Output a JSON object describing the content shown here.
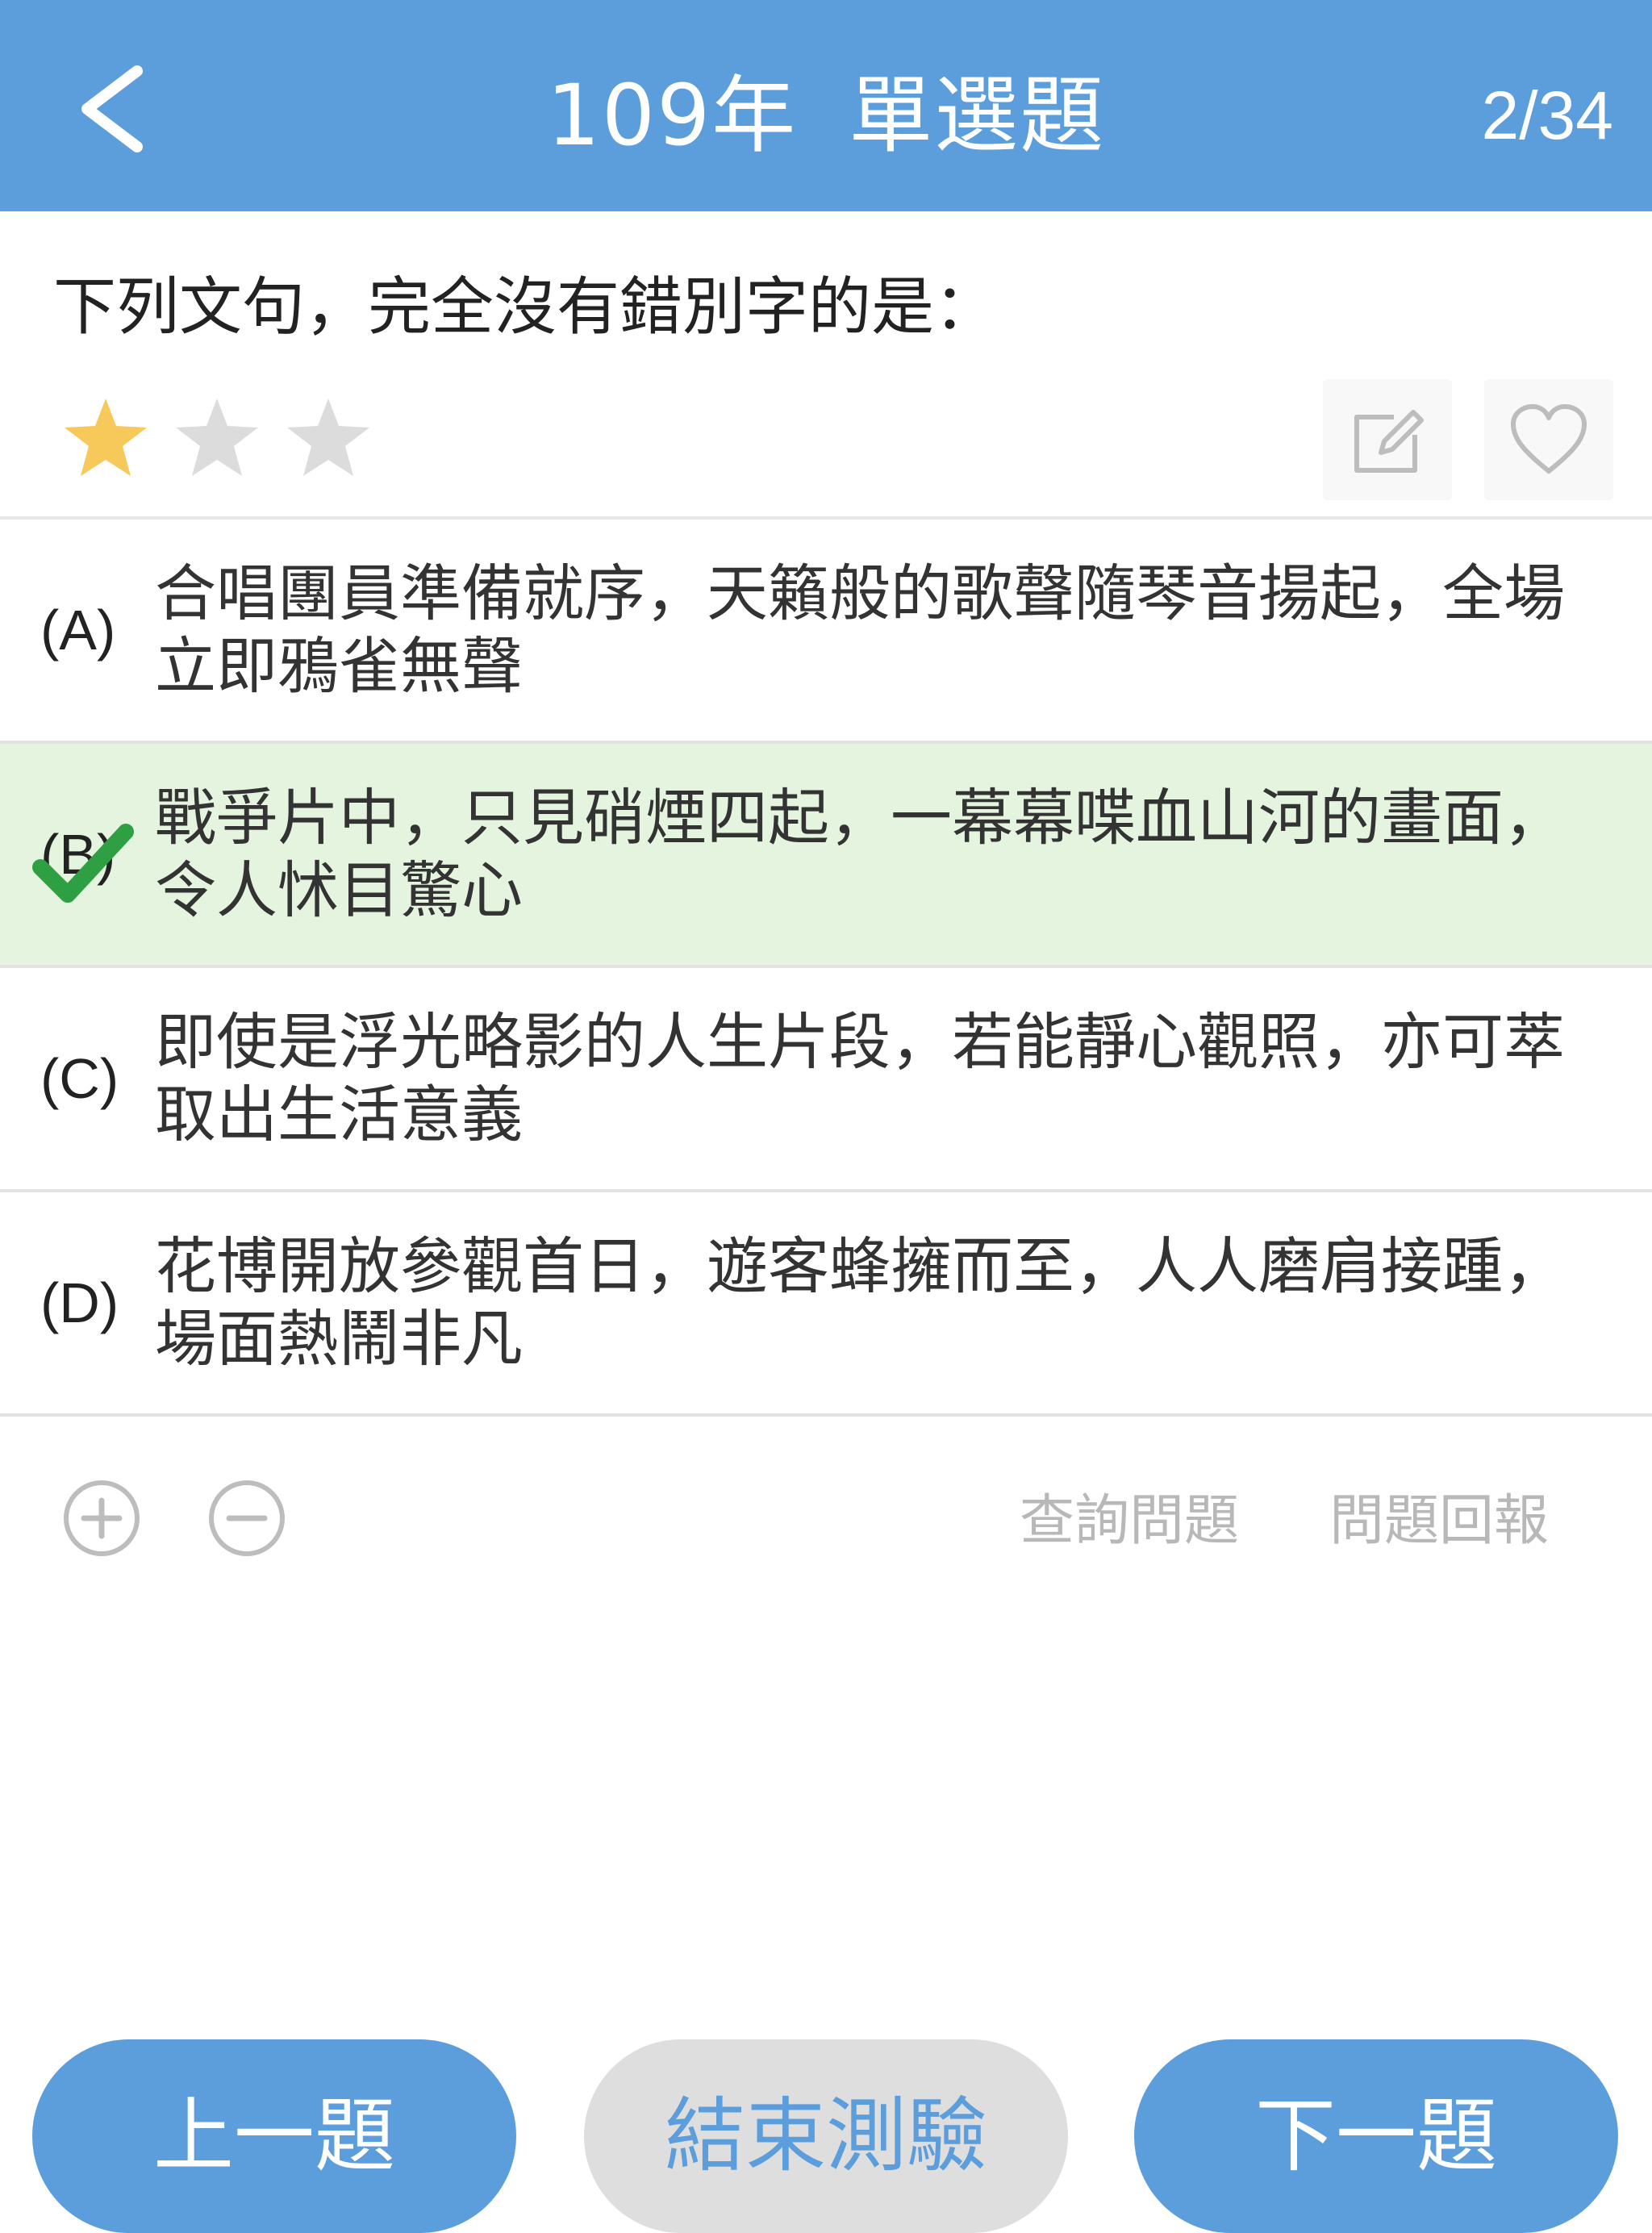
{
  "header": {
    "year": "109年",
    "title": "單選題",
    "counter": "2/34"
  },
  "question": {
    "text": "下列文句，完全沒有錯別字的是：",
    "difficulty_stars": 1,
    "max_stars": 3
  },
  "options": [
    {
      "letter": "(A)",
      "text": "合唱團員準備就序，天籟般的歌聲隨琴音揚起，全場立即鴉雀無聲",
      "selected": false
    },
    {
      "letter": "(B)",
      "text": "戰爭片中，只見硝煙四起，一幕幕喋血山河的畫面，令人怵目驚心",
      "selected": true
    },
    {
      "letter": "(C)",
      "text": "即使是浮光略影的人生片段，若能靜心觀照，亦可萃取出生活意義",
      "selected": false
    },
    {
      "letter": "(D)",
      "text": "花博開放參觀首日，遊客蜂擁而至，人人磨肩接踵，場面熱鬧非凡",
      "selected": false
    }
  ],
  "links": {
    "query": "查詢問題",
    "report": "問題回報"
  },
  "buttons": {
    "prev": "上一題",
    "end": "結束測驗",
    "next": "下一題"
  },
  "colors": {
    "header": "#5c9ddc",
    "selected_bg": "#e4f4df",
    "check": "#2ea043",
    "star_on": "#f6c95a",
    "star_off": "#dcdcdc"
  },
  "icons": {
    "back": "chevron-left-icon",
    "edit": "edit-note-icon",
    "favorite": "heart-icon",
    "zoom_in": "plus-circle-icon",
    "zoom_out": "minus-circle-icon",
    "selected": "checkmark-icon"
  }
}
